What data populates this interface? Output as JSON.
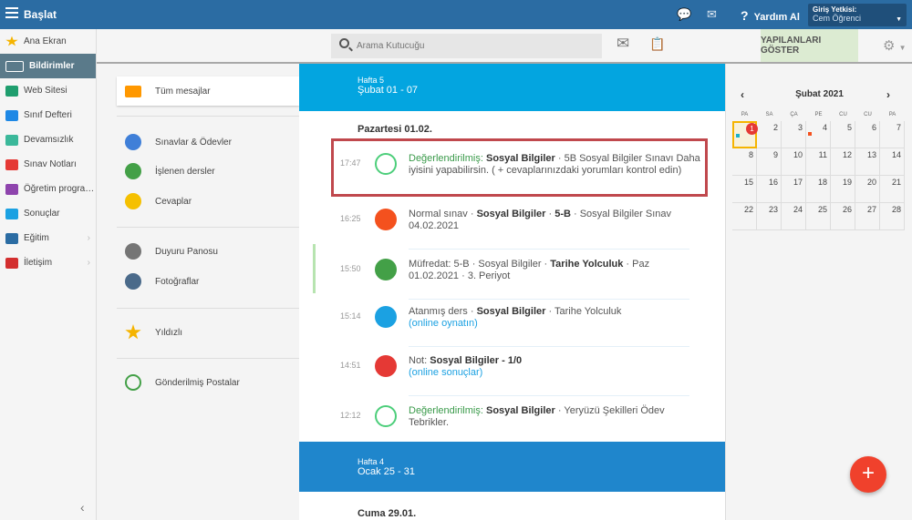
{
  "topbar": {
    "title": "Başlat",
    "help": "Yardım Al",
    "login_label": "Giriş Yetkisi:",
    "login_user": "Cem Öğrenci"
  },
  "sidebar": {
    "items": [
      {
        "label": "Ana Ekran",
        "color": "#f5b400"
      },
      {
        "label": "Bildirimler",
        "color": "#ffffff"
      },
      {
        "label": "Web Sitesi",
        "color": "#1f9e6e"
      },
      {
        "label": "Sınıf Defteri",
        "color": "#1e88e5"
      },
      {
        "label": "Devamsızlık",
        "color": "#3bb89a"
      },
      {
        "label": "Sınav Notları",
        "color": "#e53935"
      },
      {
        "label": "Öğretim progra…",
        "color": "#8e44ad"
      },
      {
        "label": "Sonuçlar",
        "color": "#1ba1e2"
      },
      {
        "label": "Eğitim",
        "color": "#2b6ca3"
      },
      {
        "label": "İletişim",
        "color": "#d32f2f"
      }
    ]
  },
  "toolbar": {
    "search_placeholder": "Arama Kutucuğu",
    "show_done": "YAPILANLARI GÖSTER"
  },
  "folders": [
    {
      "label": "Tüm mesajlar",
      "color": "#ff9800"
    },
    {
      "label": "Sınavlar & Ödevler",
      "color": "#3f7fd8"
    },
    {
      "label": "İşlenen dersler",
      "color": "#43a047"
    },
    {
      "label": "Cevaplar",
      "color": "#f5c000"
    },
    {
      "label": "Duyuru Panosu",
      "color": "#757575"
    },
    {
      "label": "Fotoğraflar",
      "color": "#4a6a8a"
    },
    {
      "label": "Yıldızlı",
      "color": "#f5b400"
    },
    {
      "label": "Gönderilmiş Postalar",
      "color": "#43a047"
    }
  ],
  "weeks": [
    {
      "label": "Hafta 5",
      "range": "Şubat 01 - 07"
    },
    {
      "label": "Hafta 4",
      "range": "Ocak 25 - 31"
    }
  ],
  "days": [
    "Pazartesi 01.02.",
    "Cuma 29.01."
  ],
  "messages": [
    {
      "time": "17:47",
      "a": "Değerlendirilmiş:",
      "b": "Sosyal Bilgiler",
      "c": "· 5B Sosyal Bilgiler Sınavı Daha iyisini yapabilirsin. ( + cevaplarınızdaki yorumları kontrol edin)"
    },
    {
      "time": "16:25",
      "a": "Normal sınav ·",
      "b": "Sosyal Bilgiler",
      "c": "·",
      "d": "5-B",
      "e": "· Sosyal Bilgiler Sınav 04.02.2021"
    },
    {
      "time": "15:50",
      "a": "Müfredat: 5-B · Sosyal Bilgiler ·",
      "b": "Tarihe Yolculuk",
      "c": "· Paz 01.02.2021 · 3. Periyot"
    },
    {
      "time": "15:14",
      "a": "Atanmış ders ·",
      "b": "Sosyal Bilgiler",
      "c": "· Tarihe Yolculuk",
      "link": "(online oynatın)"
    },
    {
      "time": "14:51",
      "a": "Not:",
      "b": "Sosyal Bilgiler - 1/0",
      "link": "(online sonuçlar)"
    },
    {
      "time": "12:12",
      "a": "Değerlendirilmiş:",
      "b": "Sosyal Bilgiler",
      "c": "· Yeryüzü Şekilleri Ödev Tebrikler."
    }
  ],
  "calendar": {
    "title": "Şubat 2021",
    "day_names": [
      "PA",
      "SA",
      "ÇA",
      "PE",
      "CU",
      "CU",
      "PA"
    ],
    "weeks": [
      [
        "1",
        "2",
        "3",
        "4",
        "5",
        "6",
        "7"
      ],
      [
        "8",
        "9",
        "10",
        "11",
        "12",
        "13",
        "14"
      ],
      [
        "15",
        "16",
        "17",
        "18",
        "19",
        "20",
        "21"
      ],
      [
        "22",
        "23",
        "24",
        "25",
        "26",
        "27",
        "28"
      ]
    ],
    "badge": "1"
  },
  "fab": "+"
}
